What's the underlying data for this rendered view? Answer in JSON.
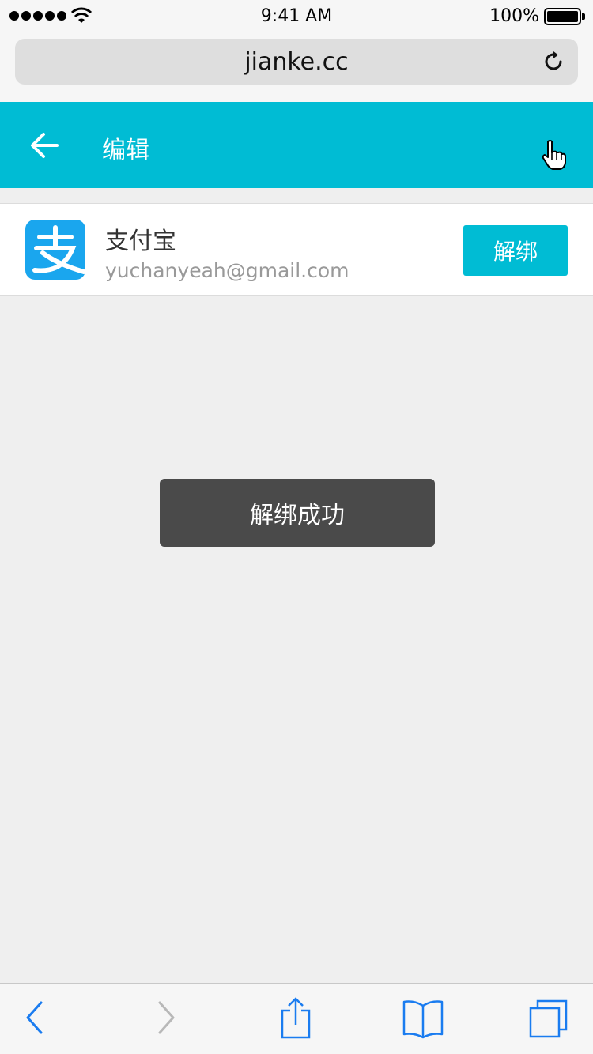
{
  "status_bar": {
    "time": "9:41 AM",
    "battery": "100%"
  },
  "browser": {
    "url": "jianke.cc"
  },
  "header": {
    "title": "编辑"
  },
  "account": {
    "name": "支付宝",
    "email": "yuchanyeah@gmail.com",
    "unbind_label": "解绑"
  },
  "toast": {
    "message": "解绑成功"
  },
  "colors": {
    "accent": "#00bcd4",
    "alipay_blue": "#1aa6ee",
    "toast_bg": "#4a4a4a",
    "ios_blue": "#1a7cf0"
  },
  "icons": {
    "back": "back-arrow-icon",
    "reload": "reload-icon",
    "cursor": "hand-cursor-icon",
    "logo": "alipay-logo-icon",
    "toolbar": [
      "browser-back-icon",
      "browser-forward-icon",
      "share-icon",
      "bookmarks-icon",
      "tabs-icon"
    ]
  }
}
